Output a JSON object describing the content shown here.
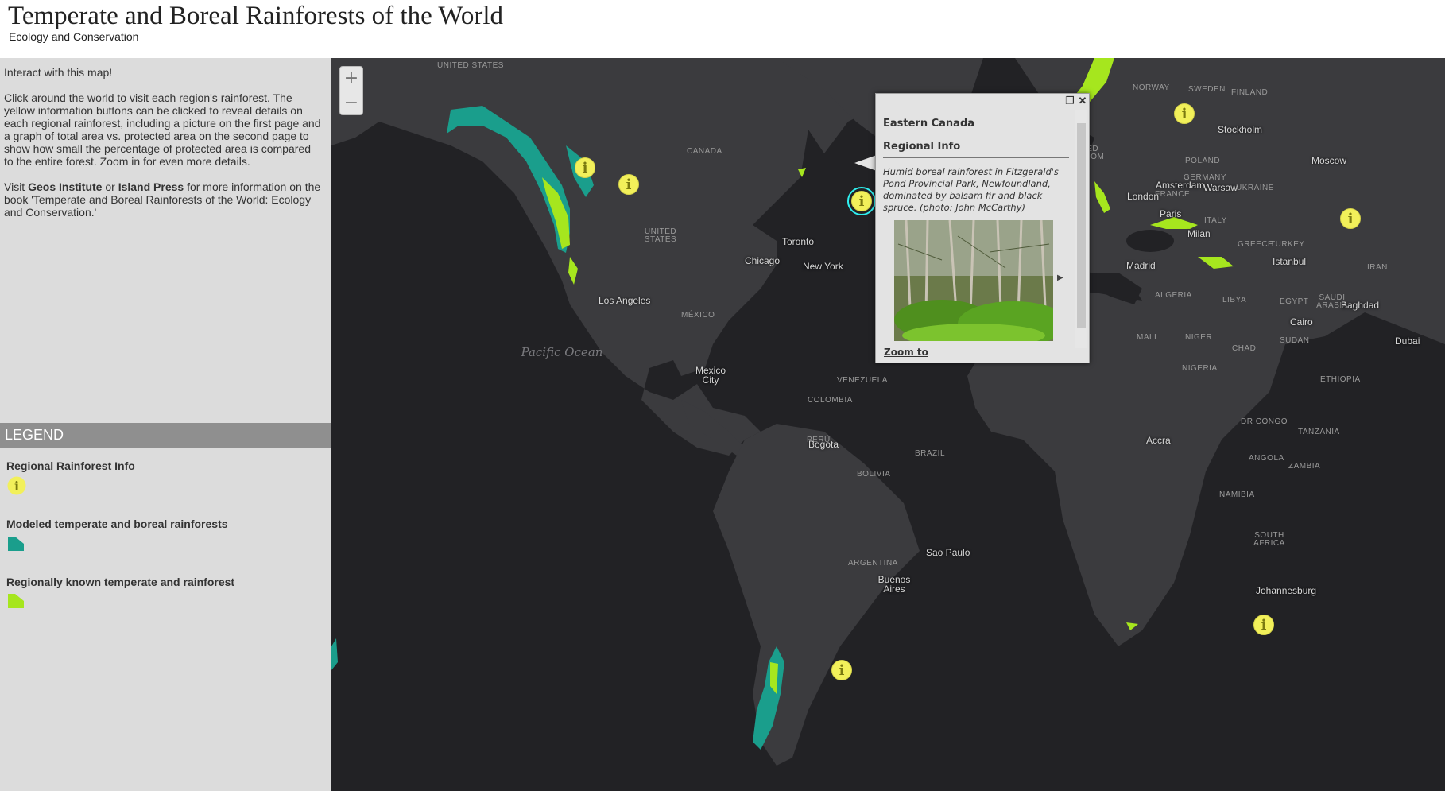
{
  "header": {
    "title": "Temperate and Boreal Rainforests of the World",
    "subtitle": "Ecology and Conservation"
  },
  "sidebar": {
    "intro": "Interact with this map!",
    "instructions": "Click around the world to visit each region's rainforest. The yellow information buttons can be clicked to reveal details on each regional rainforest, including a picture on the first page and a graph of total area vs. protected area on the second page to show how small the percentage of protected area is compared to the entire forest. Zoom in for even more details.",
    "visit_prefix": "Visit ",
    "link_geos": "Geos Institute",
    "visit_or": " or ",
    "link_island": "Island Press",
    "visit_suffix": " for more information on the book 'Temperate and Boreal Rainforests of the World: Ecology and Conservation.'"
  },
  "legend": {
    "header": "LEGEND",
    "items": [
      {
        "label": "Regional Rainforest Info",
        "symbol": "info-marker-icon",
        "color": "#f2f05a"
      },
      {
        "label": "Modeled temperate and boreal rainforests",
        "symbol": "teal-polygon",
        "color": "#1a9e8c"
      },
      {
        "label": "Regionally known temperate and rainforest",
        "symbol": "green-polygon",
        "color": "#a6e61e"
      }
    ]
  },
  "map": {
    "zoom_in": "+",
    "zoom_out": "−",
    "marker_glyph": "i",
    "colors": {
      "ocean": "#222225",
      "land": "#3b3b3e",
      "modeled": "#1a9e8c",
      "known": "#a6e61e",
      "marker": "#f2f05a"
    },
    "cities": [
      "Toronto",
      "Chicago",
      "New York",
      "Los Angeles",
      "Mexico City",
      "Bogota",
      "Sao Paulo",
      "Buenos Aires",
      "Stockholm",
      "Moscow",
      "Amsterdam",
      "London",
      "Warsaw",
      "Paris",
      "Milan",
      "Madrid",
      "Istanbul",
      "Baghdad",
      "Cairo",
      "Dubai",
      "Accra",
      "Johannesburg"
    ],
    "countries": [
      "UNITED STATES",
      "CANADA",
      "UNITED STATES",
      "MÉXICO",
      "VENEZUELA",
      "COLOMBIA",
      "PERÚ",
      "BRAZIL",
      "BOLIVIA",
      "ARGENTINA",
      "NORWAY",
      "SWEDEN",
      "FINLAND",
      "UNITED KINGDOM",
      "POLAND",
      "GERMANY",
      "UKRAINE",
      "FRANCE",
      "ITALY",
      "GREECE",
      "TURKEY",
      "IRAN",
      "ALGERIA",
      "LIBYA",
      "EGYPT",
      "SAUDI ARABIA",
      "MALI",
      "NIGER",
      "CHAD",
      "SUDAN",
      "NIGERIA",
      "ETHIOPIA",
      "DR CONGO",
      "TANZANIA",
      "ANGOLA",
      "ZAMBIA",
      "NAMIBIA",
      "SOUTH AFRICA"
    ],
    "ocean_label": "Pacific Ocean"
  },
  "popup": {
    "heading": "Eastern Canada",
    "subheading": "Regional Info",
    "description": "Humid boreal rainforest in Fitzgerald's Pond Provincial Park, Newfoundland, dominated by balsam fir and black spruce. (photo: John McCarthy)",
    "next_icon": "next-arrow-icon",
    "zoom_link": "Zoom to",
    "maximize_icon": "maximize-icon",
    "close_icon": "close-icon"
  }
}
